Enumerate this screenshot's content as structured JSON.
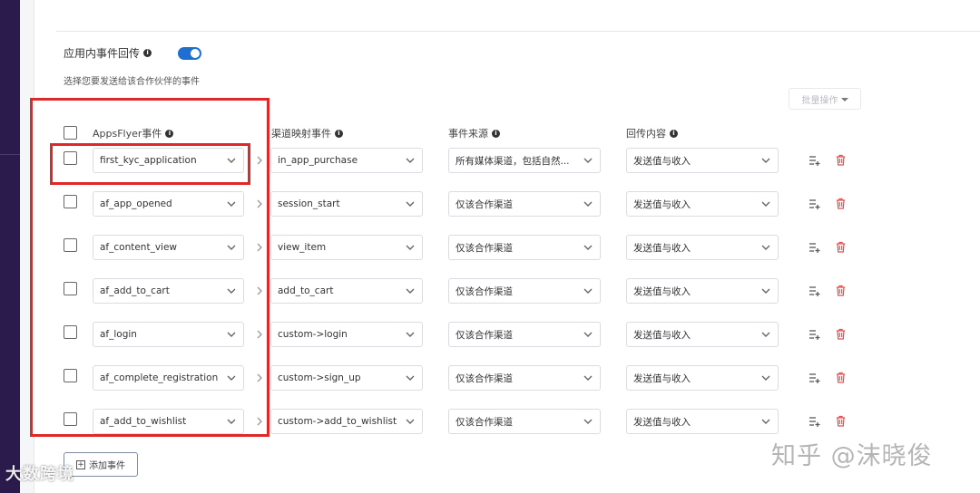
{
  "section": {
    "title": "应用内事件回传",
    "subtitle": "选择您要发送给该合作伙伴的事件",
    "toggle_on": true
  },
  "batch_action_label": "批量操作",
  "columns": {
    "appsflyer_event": "AppsFlyer事件",
    "channel_event": "渠道映射事件",
    "event_source": "事件来源",
    "postback_content": "回传内容"
  },
  "rows": [
    {
      "af_event": "first_kyc_application",
      "mapped_event": "in_app_purchase",
      "source": "所有媒体渠道，包括自然...",
      "content": "发送值与收入"
    },
    {
      "af_event": "af_app_opened",
      "mapped_event": "session_start",
      "source": "仅该合作渠道",
      "content": "发送值与收入"
    },
    {
      "af_event": "af_content_view",
      "mapped_event": "view_item",
      "source": "仅该合作渠道",
      "content": "发送值与收入"
    },
    {
      "af_event": "af_add_to_cart",
      "mapped_event": "add_to_cart",
      "source": "仅该合作渠道",
      "content": "发送值与收入"
    },
    {
      "af_event": "af_login",
      "mapped_event": "custom->login",
      "source": "仅该合作渠道",
      "content": "发送值与收入"
    },
    {
      "af_event": "af_complete_registration",
      "mapped_event": "custom->sign_up",
      "source": "仅该合作渠道",
      "content": "发送值与收入"
    },
    {
      "af_event": "af_add_to_wishlist",
      "mapped_event": "custom->add_to_wishlist",
      "source": "仅该合作渠道",
      "content": "发送值与收入"
    }
  ],
  "add_event_label": "添加事件",
  "watermarks": {
    "left": "大数跨境",
    "right": "知乎 @沫晓俊"
  },
  "colors": {
    "accent": "#1f6fd1",
    "highlight_border": "#e02828",
    "delete_icon": "#e05050",
    "sidebar": "#2b1b4d"
  },
  "icons": {
    "info": "info-circle-icon",
    "dropdown": "chevron-down-icon",
    "arrow": "chevron-right-icon",
    "add_row": "playlist-add-icon",
    "delete": "trash-icon"
  }
}
